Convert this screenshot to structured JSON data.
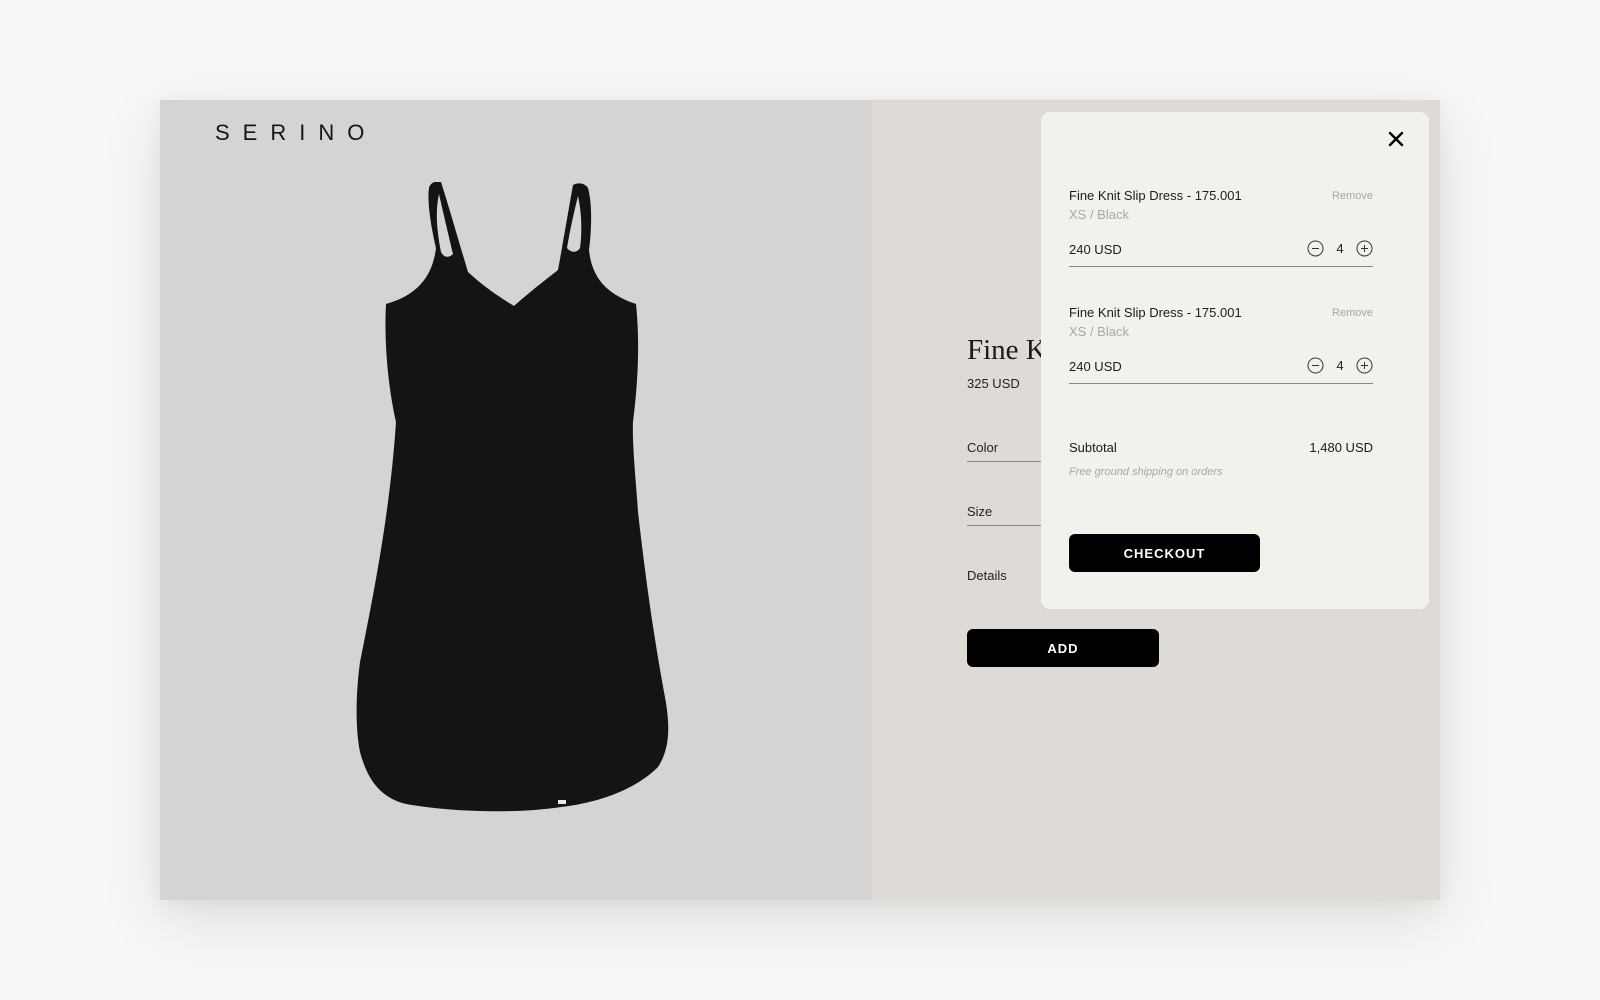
{
  "brand": {
    "logo_text": "SERINO"
  },
  "product": {
    "title": "Fine Knit Slip Dress",
    "price": "325 USD",
    "image_icon": "black-slip-dress-image",
    "options": [
      {
        "label": "Color"
      },
      {
        "label": "Size"
      },
      {
        "label": "Details"
      }
    ],
    "add_label": "ADD"
  },
  "cart": {
    "close_icon": "close-icon",
    "remove_label": "Remove",
    "items": [
      {
        "name": "Fine Knit Slip Dress - 175.001",
        "variant": "XS / Black",
        "price": "240 USD",
        "quantity": "4"
      },
      {
        "name": "Fine Knit Slip Dress - 175.001",
        "variant": "XS / Black",
        "price": "240 USD",
        "quantity": "4"
      }
    ],
    "subtotal_label": "Subtotal",
    "subtotal_value": "1,480 USD",
    "shipping_note": "Free ground shipping on orders",
    "checkout_label": "CHECKOUT"
  },
  "colors": {
    "image_bg": "#d5d4d2",
    "panel_bg": "#dedbd6",
    "cart_bg": "#f3f1ec",
    "button": "#000000",
    "muted_text": "#aaa7a2"
  }
}
